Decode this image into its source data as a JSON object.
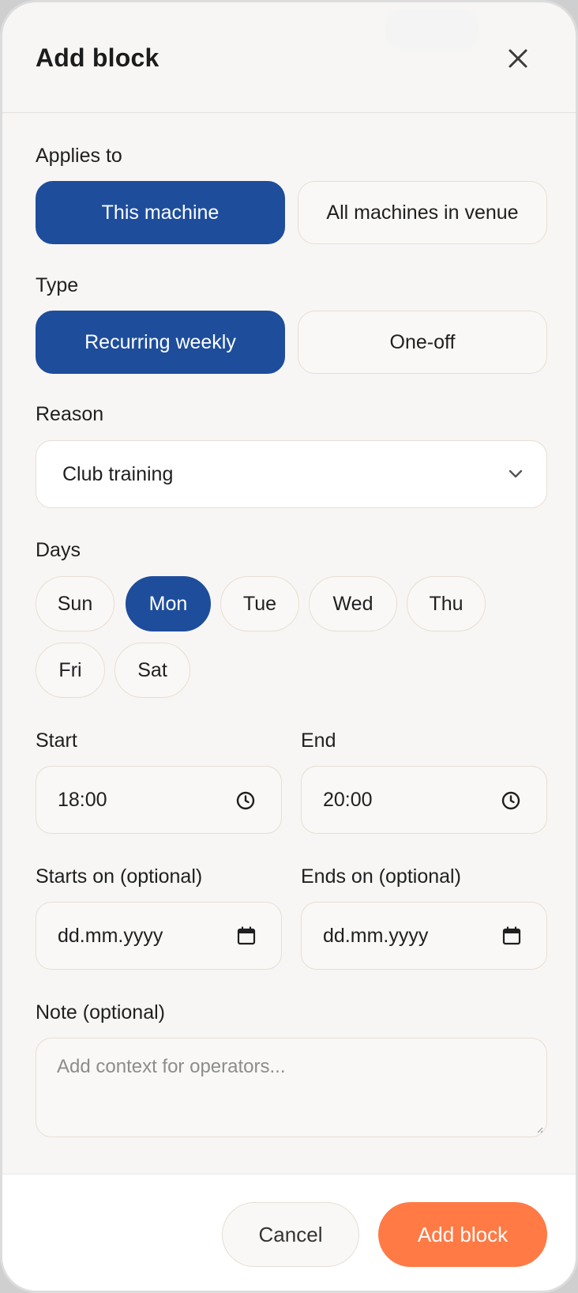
{
  "header": {
    "title": "Add block",
    "close_icon": "close-icon"
  },
  "applies_to": {
    "label": "Applies to",
    "options": [
      "This machine",
      "All machines in venue"
    ],
    "selected": "This machine"
  },
  "type": {
    "label": "Type",
    "options": [
      "Recurring weekly",
      "One-off"
    ],
    "selected": "Recurring weekly"
  },
  "reason": {
    "label": "Reason",
    "value": "Club training",
    "icon": "chevron-down-icon"
  },
  "days": {
    "label": "Days",
    "items": [
      "Sun",
      "Mon",
      "Tue",
      "Wed",
      "Thu",
      "Fri",
      "Sat"
    ],
    "selected": [
      "Mon"
    ]
  },
  "start": {
    "label": "Start",
    "value": "18:00",
    "icon": "clock-icon"
  },
  "end": {
    "label": "End",
    "value": "20:00",
    "icon": "clock-icon"
  },
  "starts_on": {
    "label": "Starts on (optional)",
    "value": "dd.mm.yyyy",
    "icon": "calendar-icon"
  },
  "ends_on": {
    "label": "Ends on (optional)",
    "value": "dd.mm.yyyy",
    "icon": "calendar-icon"
  },
  "note": {
    "label": "Note (optional)",
    "placeholder": "Add context for operators..."
  },
  "footer": {
    "cancel_label": "Cancel",
    "submit_label": "Add block"
  },
  "colors": {
    "primary": "#1e4d9b",
    "accent": "#ff7a45",
    "border": "#e7ded3"
  }
}
